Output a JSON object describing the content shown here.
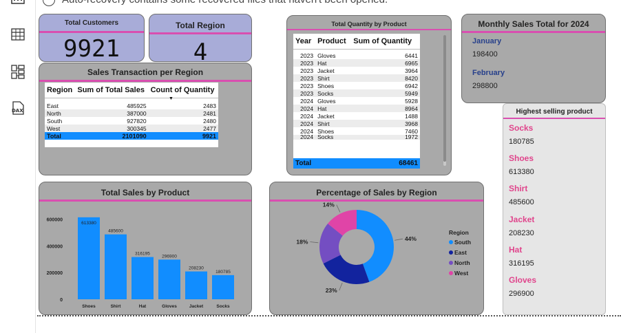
{
  "notice": {
    "text": "Auto-recovery contains some recovered files that haven't been opened."
  },
  "rail": {
    "icons": [
      "report-view-icon",
      "table-view-icon",
      "model-view-icon",
      "dax-query-icon"
    ],
    "dax_label": "DAX"
  },
  "total_customers": {
    "title": "Total Customers",
    "value": "9921"
  },
  "total_region": {
    "title": "Total Region",
    "value": "4"
  },
  "sales_transaction": {
    "title": "Sales Transaction per Region",
    "columns": [
      "Region",
      "Sum of Total Sales",
      "Count of Quantity"
    ],
    "rows": [
      [
        "East",
        "485925",
        "2483"
      ],
      [
        "North",
        "387000",
        "2481"
      ],
      [
        "South",
        "927820",
        "2480"
      ],
      [
        "West",
        "300345",
        "2477"
      ]
    ],
    "total": [
      "Total",
      "2101090",
      "9921"
    ]
  },
  "quantity_by_product": {
    "title": "Total Quantity by Product",
    "columns": [
      "Year",
      "Product",
      "Sum of Quantity"
    ],
    "rows": [
      [
        "2023",
        "Gloves",
        "6441"
      ],
      [
        "2023",
        "Hat",
        "6965"
      ],
      [
        "2023",
        "Jacket",
        "3964"
      ],
      [
        "2023",
        "Shirt",
        "8420"
      ],
      [
        "2023",
        "Shoes",
        "6942"
      ],
      [
        "2023",
        "Socks",
        "5949"
      ],
      [
        "2024",
        "Gloves",
        "5928"
      ],
      [
        "2024",
        "Hat",
        "8964"
      ],
      [
        "2024",
        "Jacket",
        "1488"
      ],
      [
        "2024",
        "Shirt",
        "3968"
      ],
      [
        "2024",
        "Shoes",
        "7460"
      ],
      [
        "2024",
        "Socks",
        "1972"
      ]
    ],
    "total": [
      "Total",
      "",
      "68461"
    ]
  },
  "monthly_sales": {
    "title": "Monthly Sales Total for 2024",
    "months": [
      {
        "name": "January",
        "value": "198400"
      },
      {
        "name": "February",
        "value": "298800"
      }
    ]
  },
  "highest_selling": {
    "title": "Highest selling product",
    "items": [
      {
        "name": "Socks",
        "value": "180785"
      },
      {
        "name": "Shoes",
        "value": "613380"
      },
      {
        "name": "Shirt",
        "value": "485600"
      },
      {
        "name": "Jacket",
        "value": "208230"
      },
      {
        "name": "Hat",
        "value": "316195"
      },
      {
        "name": "Gloves",
        "value": "296900"
      }
    ]
  },
  "colors": {
    "accent_pink": "#d94fb0",
    "bar_blue": "#118dff",
    "card_gray": "#a9a9a9",
    "card_purple": "#a8acd8"
  },
  "chart_data": [
    {
      "type": "bar",
      "title": "Total Sales by Product",
      "categories": [
        "Shoes",
        "Shirt",
        "Hat",
        "Gloves",
        "Jacket",
        "Socks"
      ],
      "values": [
        613380,
        485600,
        316195,
        296900,
        208230,
        180785
      ],
      "yticks": [
        "0",
        "200000",
        "400000",
        "600000"
      ],
      "ylim": [
        0,
        700000
      ],
      "color": "#118dff"
    },
    {
      "type": "pie",
      "title": "Percentage of Sales by Region",
      "legend_title": "Region",
      "categories": [
        "South",
        "East",
        "North",
        "West"
      ],
      "values": [
        44,
        23,
        18,
        14
      ],
      "labels": [
        "44%",
        "23%",
        "18%",
        "14%"
      ],
      "colors": [
        "#118dff",
        "#12239e",
        "#744ec2",
        "#e044a7"
      ],
      "legend_position": "right"
    }
  ]
}
